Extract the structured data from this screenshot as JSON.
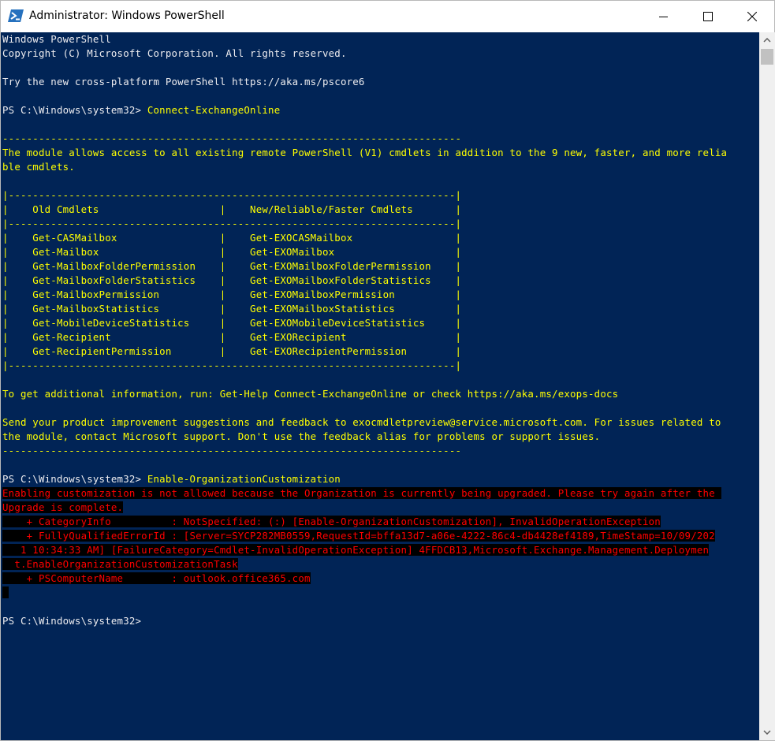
{
  "window": {
    "title": "Administrator: Windows PowerShell",
    "icon": "powershell-icon",
    "controls": [
      "minimize-icon",
      "maximize-icon",
      "close-icon"
    ]
  },
  "colors": {
    "console_background": "#012456",
    "default_text": "#eeedf0",
    "warning_text": "#ffff00",
    "error_text": "#ff0000",
    "error_background": "#000000"
  },
  "console": {
    "lines": [
      {
        "text": "Windows PowerShell",
        "style": "w"
      },
      {
        "text": "Copyright (C) Microsoft Corporation. All rights reserved.",
        "style": "w"
      },
      {
        "text": "",
        "style": "w"
      },
      {
        "text": "Try the new cross-platform PowerShell https://aka.ms/pscore6",
        "style": "w"
      },
      {
        "text": "",
        "style": "w"
      },
      {
        "prompt": "PS C:\\Windows\\system32> ",
        "command": "Connect-ExchangeOnline"
      },
      {
        "text": "",
        "style": "w"
      },
      {
        "text": "----------------------------------------------------------------------------",
        "style": "y"
      },
      {
        "text": "The module allows access to all existing remote PowerShell (V1) cmdlets in addition to the 9 new, faster, and more relia",
        "style": "y"
      },
      {
        "text": "ble cmdlets.",
        "style": "y"
      },
      {
        "text": "",
        "style": "w"
      },
      {
        "text": "|--------------------------------------------------------------------------|",
        "style": "y"
      },
      {
        "text": "|    Old Cmdlets                    |    New/Reliable/Faster Cmdlets       |",
        "style": "y"
      },
      {
        "text": "|--------------------------------------------------------------------------|",
        "style": "y"
      },
      {
        "text": "|    Get-CASMailbox                 |    Get-EXOCASMailbox                 |",
        "style": "y"
      },
      {
        "text": "|    Get-Mailbox                    |    Get-EXOMailbox                    |",
        "style": "y"
      },
      {
        "text": "|    Get-MailboxFolderPermission    |    Get-EXOMailboxFolderPermission    |",
        "style": "y"
      },
      {
        "text": "|    Get-MailboxFolderStatistics    |    Get-EXOMailboxFolderStatistics    |",
        "style": "y"
      },
      {
        "text": "|    Get-MailboxPermission          |    Get-EXOMailboxPermission          |",
        "style": "y"
      },
      {
        "text": "|    Get-MailboxStatistics          |    Get-EXOMailboxStatistics          |",
        "style": "y"
      },
      {
        "text": "|    Get-MobileDeviceStatistics     |    Get-EXOMobileDeviceStatistics     |",
        "style": "y"
      },
      {
        "text": "|    Get-Recipient                  |    Get-EXORecipient                  |",
        "style": "y"
      },
      {
        "text": "|    Get-RecipientPermission        |    Get-EXORecipientPermission        |",
        "style": "y"
      },
      {
        "text": "|--------------------------------------------------------------------------|",
        "style": "y"
      },
      {
        "text": "",
        "style": "w"
      },
      {
        "text": "To get additional information, run: Get-Help Connect-ExchangeOnline or check https://aka.ms/exops-docs",
        "style": "y"
      },
      {
        "text": "",
        "style": "w"
      },
      {
        "text": "Send your product improvement suggestions and feedback to exocmdletpreview@service.microsoft.com. For issues related to",
        "style": "y"
      },
      {
        "text": "the module, contact Microsoft support. Don't use the feedback alias for problems or support issues.",
        "style": "y"
      },
      {
        "text": "----------------------------------------------------------------------------",
        "style": "y"
      },
      {
        "text": "",
        "style": "w"
      },
      {
        "prompt": "PS C:\\Windows\\system32> ",
        "command": "Enable-OrganizationCustomization"
      },
      {
        "text": "Enabling customization is not allowed because the Organization is currently being upgraded. Please try again after the ",
        "style": "err"
      },
      {
        "text": "Upgrade is complete.",
        "style": "err"
      },
      {
        "text": "    + CategoryInfo          : NotSpecified: (:) [Enable-OrganizationCustomization], InvalidOperationException",
        "style": "err"
      },
      {
        "text": "    + FullyQualifiedErrorId : [Server=SYCP282MB0559,RequestId=bffa13d7-a06e-4222-86c4-db4428ef4189,TimeStamp=10/09/202",
        "style": "err"
      },
      {
        "text": "   1 10:34:33 AM] [FailureCategory=Cmdlet-InvalidOperationException] 4FFDCB13,Microsoft.Exchange.Management.Deploymen",
        "style": "err"
      },
      {
        "text": "  t.EnableOrganizationCustomizationTask",
        "style": "err"
      },
      {
        "text": "    + PSComputerName        : outlook.office365.com",
        "style": "err"
      },
      {
        "text": " ",
        "style": "err"
      },
      {
        "text": "",
        "style": "w"
      },
      {
        "text": "PS C:\\Windows\\system32>",
        "style": "w"
      }
    ]
  },
  "scrollbar": {
    "up_icon": "scroll-up-arrow-icon",
    "down_icon": "scroll-down-arrow-icon"
  }
}
